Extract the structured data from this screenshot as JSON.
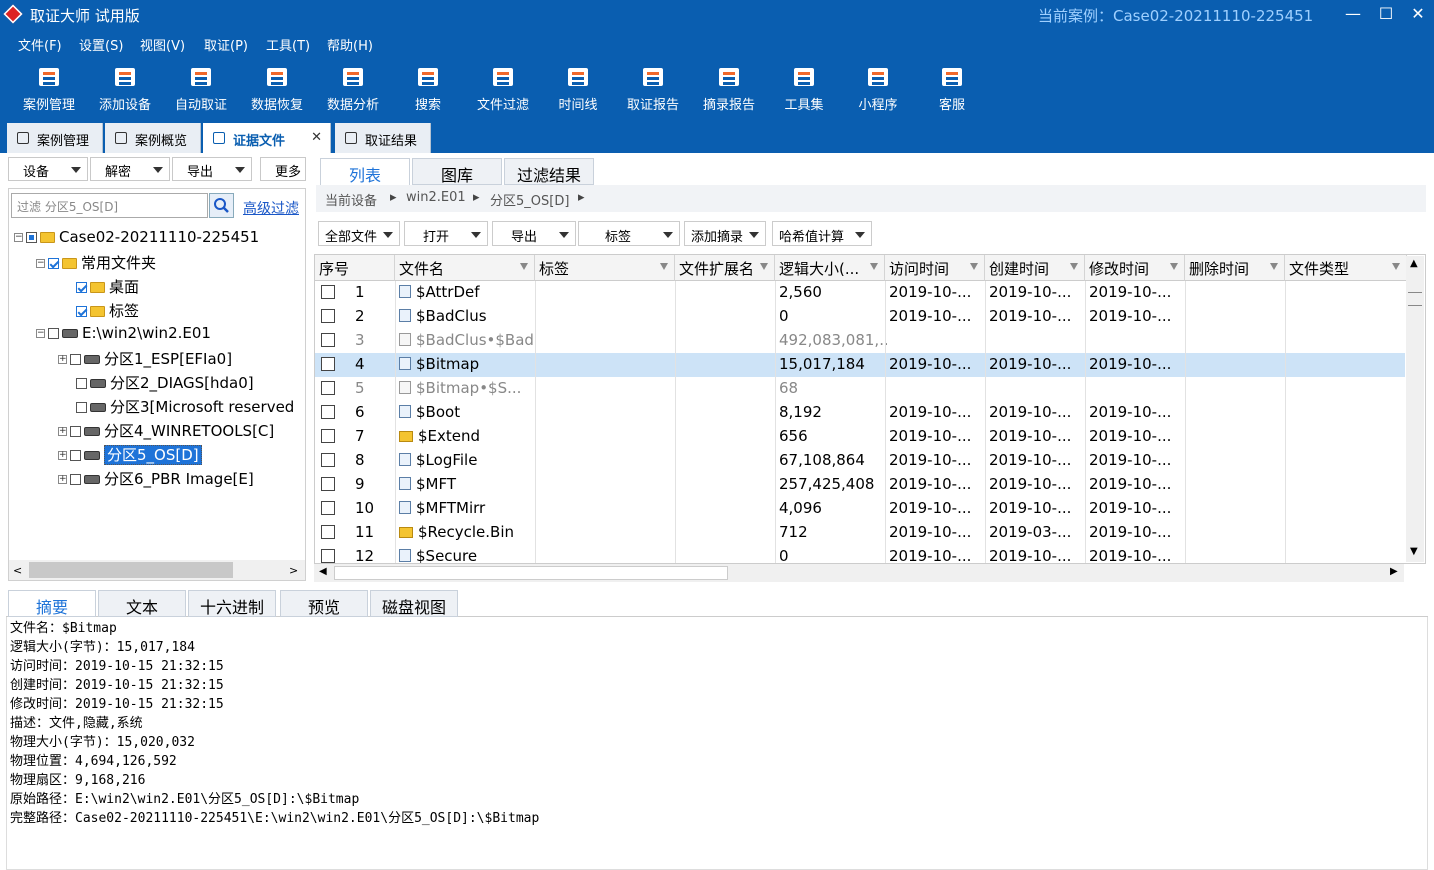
{
  "window": {
    "title": "取证大师 试用版",
    "current_case": "当前案例：Case02-20211110-225451",
    "min": "—",
    "max": "☐",
    "close": "✕"
  },
  "menu": [
    "文件(F)",
    "设置(S)",
    "视图(V)",
    "取证(P)",
    "工具(T)",
    "帮助(H)"
  ],
  "toolbar": [
    "案例管理",
    "添加设备",
    "自动取证",
    "数据恢复",
    "数据分析",
    "搜索",
    "文件过滤",
    "时间线",
    "取证报告",
    "摘录报告",
    "工具集",
    "小程序",
    "客服"
  ],
  "doc_tabs": [
    "案例管理",
    "案例概览",
    "证据文件",
    "取证结果"
  ],
  "doc_tab_close": "✕",
  "left_toolbar": [
    "设备",
    "解密",
    "导出",
    "更多"
  ],
  "filter": {
    "placeholder": "过滤 分区5_OS[D]",
    "search_icon": "search-icon",
    "advanced": "高级过滤"
  },
  "tree": [
    {
      "label": "Case02-20211110-225451"
    },
    {
      "label": "常用文件夹"
    },
    {
      "label": "桌面"
    },
    {
      "label": "标签"
    },
    {
      "label": "E:\\win2\\win2.E01"
    },
    {
      "label": "分区1_ESP[EFIa0]"
    },
    {
      "label": "分区2_DIAGS[hda0]"
    },
    {
      "label": "分区3[Microsoft reserved"
    },
    {
      "label": "分区4_WINRETOOLS[C]"
    },
    {
      "label": "分区5_OS[D]"
    },
    {
      "label": "分区6_PBR Image[E]"
    }
  ],
  "view_tabs": [
    "列表",
    "图库",
    "过滤结果"
  ],
  "breadcrumb": [
    "当前设备",
    "win2.E01",
    "分区5_OS[D]"
  ],
  "filter_buttons": [
    "全部文件",
    "打开",
    "导出",
    "标签",
    "添加摘录",
    "哈希值计算"
  ],
  "columns": [
    "序号",
    "文件名",
    "标签",
    "文件扩展名",
    "逻辑大小(...",
    "访问时间",
    "创建时间",
    "修改时间",
    "删除时间",
    "文件类型"
  ],
  "rows": [
    {
      "n": "1",
      "name": "$AttrDef",
      "size": "2,560",
      "atime": "2019-10-...",
      "ctime": "2019-10-...",
      "mtime": "2019-10-..."
    },
    {
      "n": "2",
      "name": "$BadClus",
      "size": "0",
      "atime": "2019-10-...",
      "ctime": "2019-10-...",
      "mtime": "2019-10-..."
    },
    {
      "n": "3",
      "name": "$BadClus•$Bad",
      "size": "492,083,081,...",
      "atime": "",
      "ctime": "",
      "mtime": ""
    },
    {
      "n": "4",
      "name": "$Bitmap",
      "size": "15,017,184",
      "atime": "2019-10-...",
      "ctime": "2019-10-...",
      "mtime": "2019-10-..."
    },
    {
      "n": "5",
      "name": "$Bitmap•$S...",
      "size": "68",
      "atime": "",
      "ctime": "",
      "mtime": ""
    },
    {
      "n": "6",
      "name": "$Boot",
      "size": "8,192",
      "atime": "2019-10-...",
      "ctime": "2019-10-...",
      "mtime": "2019-10-..."
    },
    {
      "n": "7",
      "name": "$Extend",
      "size": "656",
      "atime": "2019-10-...",
      "ctime": "2019-10-...",
      "mtime": "2019-10-..."
    },
    {
      "n": "8",
      "name": "$LogFile",
      "size": "67,108,864",
      "atime": "2019-10-...",
      "ctime": "2019-10-...",
      "mtime": "2019-10-..."
    },
    {
      "n": "9",
      "name": "$MFT",
      "size": "257,425,408",
      "atime": "2019-10-...",
      "ctime": "2019-10-...",
      "mtime": "2019-10-..."
    },
    {
      "n": "10",
      "name": "$MFTMirr",
      "size": "4,096",
      "atime": "2019-10-...",
      "ctime": "2019-10-...",
      "mtime": "2019-10-..."
    },
    {
      "n": "11",
      "name": "$Recycle.Bin",
      "size": "712",
      "atime": "2019-10-...",
      "ctime": "2019-03-...",
      "mtime": "2019-10-..."
    },
    {
      "n": "12",
      "name": "$Secure",
      "size": "0",
      "atime": "2019-10-...",
      "ctime": "2019-10-...",
      "mtime": "2019-10-..."
    }
  ],
  "bottom_tabs": [
    "摘要",
    "文本",
    "十六进制",
    "预览",
    "磁盘视图"
  ],
  "summary": [
    "文件名：$Bitmap",
    "逻辑大小(字节)：15,017,184",
    "访问时间：2019-10-15 21:32:15",
    "创建时间：2019-10-15 21:32:15",
    "修改时间：2019-10-15 21:32:15",
    "描述：文件,隐藏,系统",
    "物理大小(字节)：15,020,032",
    "物理位置：4,694,126,592",
    "物理扇区：9,168,216",
    "原始路径：E:\\win2\\win2.E01\\分区5_OS[D]:\\$Bitmap",
    "完整路径：Case02-20211110-225451\\E:\\win2\\win2.E01\\分区5_OS[D]:\\$Bitmap"
  ],
  "colors": {
    "brand": "#0a5eb0",
    "accent": "#f0682a",
    "selection": "#cde3f7"
  }
}
